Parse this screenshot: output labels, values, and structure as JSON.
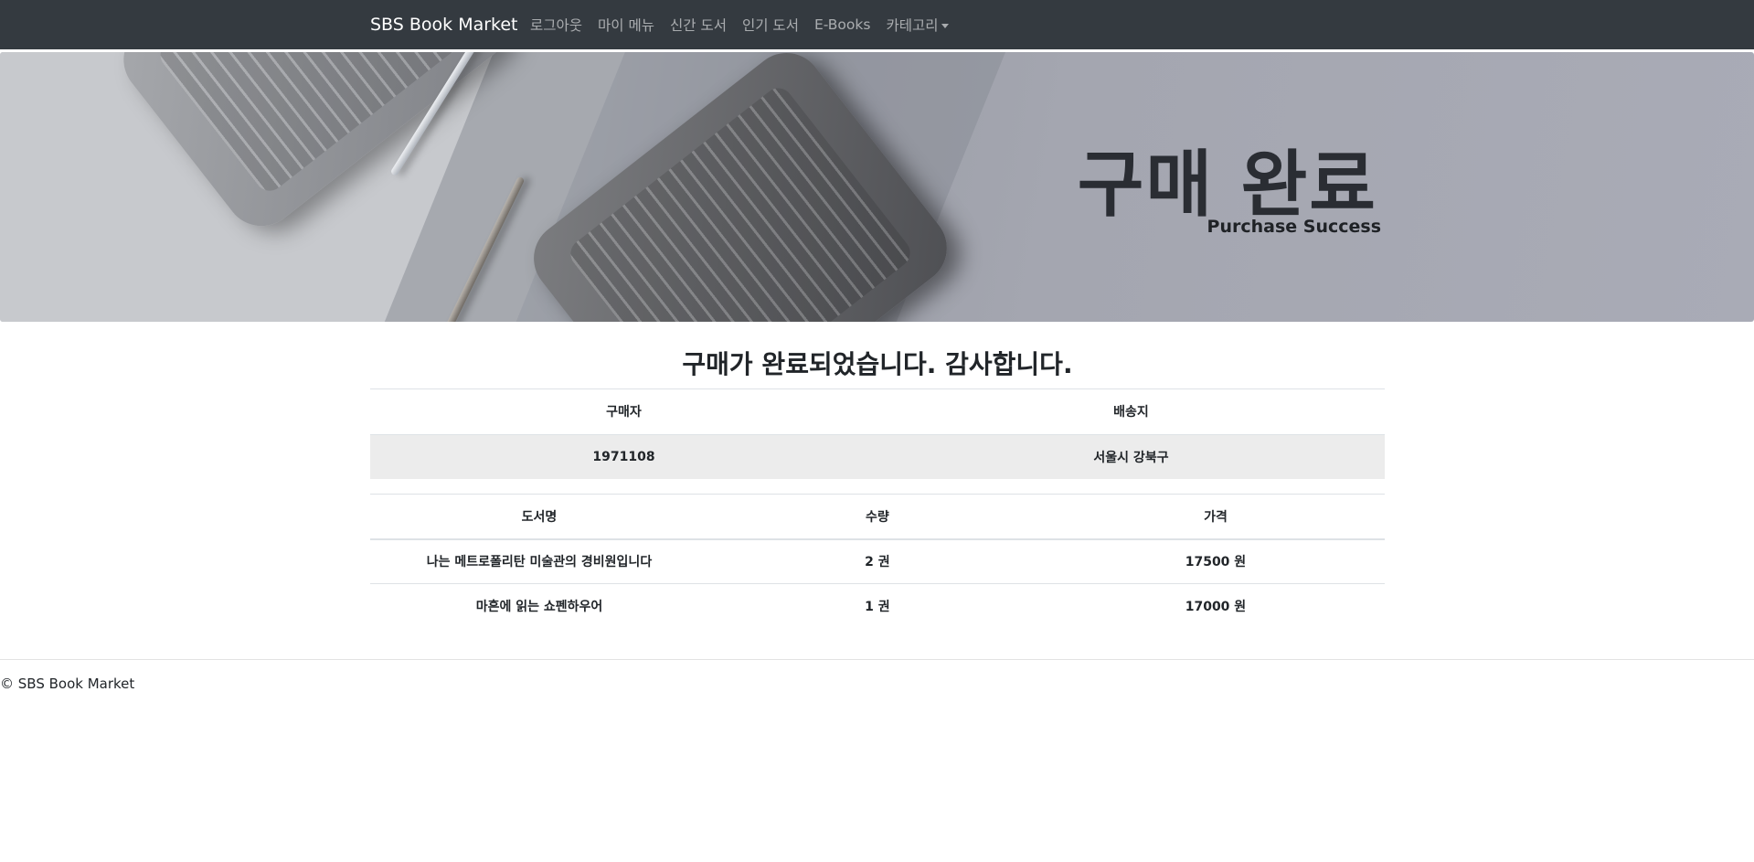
{
  "navbar": {
    "brand": "SBS Book Market",
    "links": [
      {
        "label": "로그아웃"
      },
      {
        "label": "마이 메뉴"
      },
      {
        "label": "신간 도서"
      },
      {
        "label": "인기 도서"
      },
      {
        "label": "E-Books"
      },
      {
        "label": "카테고리",
        "has_dropdown": true
      }
    ]
  },
  "hero": {
    "title": "구매 완료",
    "subtitle": "Purchase Success"
  },
  "message": "구매가 완료되었습니다. 감사합니다.",
  "order_info": {
    "headers": [
      "구매자",
      "배송지"
    ],
    "row": [
      "1971108",
      "서울시 강북구"
    ]
  },
  "books": {
    "headers": [
      "도서명",
      "수량",
      "가격"
    ],
    "rows": [
      [
        "나는 메트로폴리탄 미술관의 경비원입니다",
        "2 권",
        "17500 원"
      ],
      [
        "마흔에 읽는 쇼펜하우어",
        "1 권",
        "17000 원"
      ]
    ]
  },
  "footer": "© SBS Book Market",
  "colors": {
    "navbar_bg": "#343a40",
    "row_highlight": "#ececec"
  }
}
